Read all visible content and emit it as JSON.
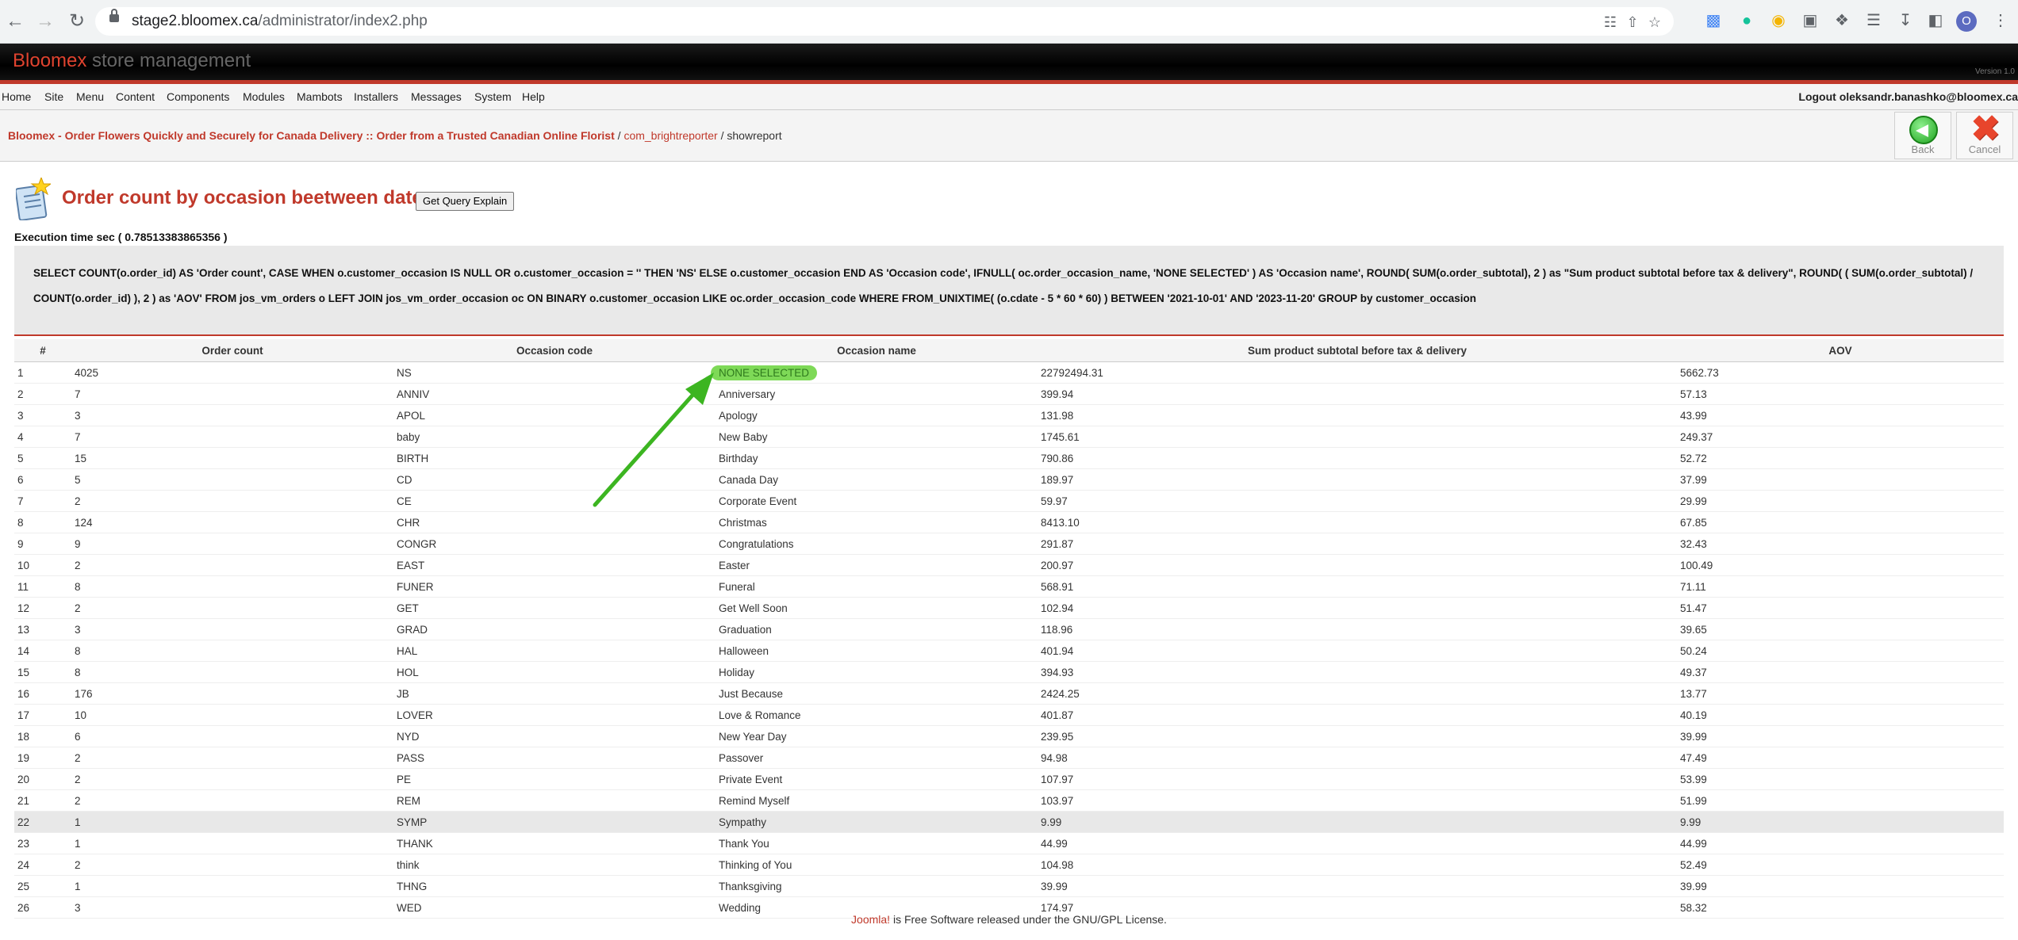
{
  "browser": {
    "url_host": "stage2.bloomex.ca",
    "url_path": "/administrator/index2.php",
    "profile_initial": "O"
  },
  "header": {
    "logo": "Bloomex",
    "logo_sub": "store management",
    "version": "Version 1.0"
  },
  "menu": {
    "items": [
      "Home",
      "Site",
      "Menu",
      "Content",
      "Components",
      "Modules",
      "Mambots",
      "Installers",
      "Messages",
      "System",
      "Help"
    ],
    "logout": "Logout oleksandr.banashko@bloomex.ca"
  },
  "pathway": {
    "site": "Bloomex - Order Flowers Quickly and Securely for Canada Delivery :: Order from a Trusted Canadian Online Florist",
    "sep1": " / ",
    "component": "com_brightreporter",
    "sep2": " / ",
    "task": "showreport"
  },
  "toolbar": {
    "back_label": "Back",
    "cancel_label": "Cancel"
  },
  "page": {
    "title": "Order count by occasion beetween dates",
    "query_button": "Get Query Explain",
    "exec_time": "Execution time sec ( 0.78513383865356 )",
    "query": "SELECT COUNT(o.order_id) AS 'Order count', CASE WHEN o.customer_occasion IS NULL OR o.customer_occasion = '' THEN 'NS' ELSE o.customer_occasion END AS 'Occasion code', IFNULL( oc.order_occasion_name, 'NONE SELECTED' ) AS 'Occasion name', ROUND( SUM(o.order_subtotal), 2 ) as \"Sum product subtotal before tax & delivery\", ROUND( ( SUM(o.order_subtotal) / COUNT(o.order_id) ), 2 ) as 'AOV' FROM jos_vm_orders o LEFT JOIN jos_vm_order_occasion oc ON BINARY o.customer_occasion LIKE oc.order_occasion_code WHERE FROM_UNIXTIME( (o.cdate - 5 * 60 * 60) ) BETWEEN '2021-10-01' AND '2023-11-20' GROUP by customer_occasion"
  },
  "table": {
    "columns": [
      "#",
      "Order count",
      "Occasion code",
      "Occasion name",
      "Sum product subtotal before tax & delivery",
      "AOV"
    ],
    "rows": [
      [
        "1",
        "4025",
        "NS",
        "NONE SELECTED",
        "22792494.31",
        "5662.73"
      ],
      [
        "2",
        "7",
        "ANNIV",
        "Anniversary",
        "399.94",
        "57.13"
      ],
      [
        "3",
        "3",
        "APOL",
        "Apology",
        "131.98",
        "43.99"
      ],
      [
        "4",
        "7",
        "baby",
        "New Baby",
        "1745.61",
        "249.37"
      ],
      [
        "5",
        "15",
        "BIRTH",
        "Birthday",
        "790.86",
        "52.72"
      ],
      [
        "6",
        "5",
        "CD",
        "Canada Day",
        "189.97",
        "37.99"
      ],
      [
        "7",
        "2",
        "CE",
        "Corporate Event",
        "59.97",
        "29.99"
      ],
      [
        "8",
        "124",
        "CHR",
        "Christmas",
        "8413.10",
        "67.85"
      ],
      [
        "9",
        "9",
        "CONGR",
        "Congratulations",
        "291.87",
        "32.43"
      ],
      [
        "10",
        "2",
        "EAST",
        "Easter",
        "200.97",
        "100.49"
      ],
      [
        "11",
        "8",
        "FUNER",
        "Funeral",
        "568.91",
        "71.11"
      ],
      [
        "12",
        "2",
        "GET",
        "Get Well Soon",
        "102.94",
        "51.47"
      ],
      [
        "13",
        "3",
        "GRAD",
        "Graduation",
        "118.96",
        "39.65"
      ],
      [
        "14",
        "8",
        "HAL",
        "Halloween",
        "401.94",
        "50.24"
      ],
      [
        "15",
        "8",
        "HOL",
        "Holiday",
        "394.93",
        "49.37"
      ],
      [
        "16",
        "176",
        "JB",
        "Just Because",
        "2424.25",
        "13.77"
      ],
      [
        "17",
        "10",
        "LOVER",
        "Love & Romance",
        "401.87",
        "40.19"
      ],
      [
        "18",
        "6",
        "NYD",
        "New Year Day",
        "239.95",
        "39.99"
      ],
      [
        "19",
        "2",
        "PASS",
        "Passover",
        "94.98",
        "47.49"
      ],
      [
        "20",
        "2",
        "PE",
        "Private Event",
        "107.97",
        "53.99"
      ],
      [
        "21",
        "2",
        "REM",
        "Remind Myself",
        "103.97",
        "51.99"
      ],
      [
        "22",
        "1",
        "SYMP",
        "Sympathy",
        "9.99",
        "9.99"
      ],
      [
        "23",
        "1",
        "THANK",
        "Thank You",
        "44.99",
        "44.99"
      ],
      [
        "24",
        "2",
        "think",
        "Thinking of You",
        "104.98",
        "52.49"
      ],
      [
        "25",
        "1",
        "THNG",
        "Thanksgiving",
        "39.99",
        "39.99"
      ],
      [
        "26",
        "3",
        "WED",
        "Wedding",
        "174.97",
        "58.32"
      ]
    ]
  },
  "footer": {
    "joomla": "Joomla!",
    "text": " is Free Software released under the GNU/GPL License."
  },
  "colors": {
    "brand_red": "#c0392b",
    "highlight_green": "#7ed957",
    "arrow_green": "#3cb521"
  }
}
